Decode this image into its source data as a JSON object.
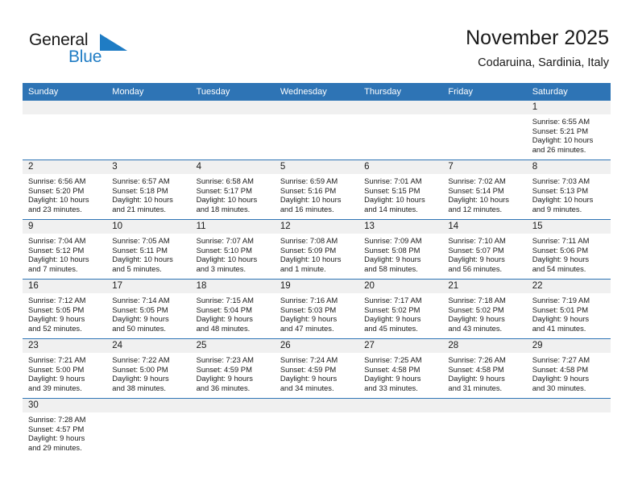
{
  "brand": {
    "name_top": "General",
    "name_bottom": "Blue",
    "accent_color": "#1f7cc4",
    "dark_color": "#1a1a1a"
  },
  "header": {
    "title": "November 2025",
    "subtitle": "Codaruina, Sardinia, Italy"
  },
  "theme": {
    "header_row_bg": "#2e74b5",
    "day_band_bg": "#f0f0f0",
    "row_divider": "#2e74b5",
    "text": "#1a1a1a"
  },
  "weekdays": [
    "Sunday",
    "Monday",
    "Tuesday",
    "Wednesday",
    "Thursday",
    "Friday",
    "Saturday"
  ],
  "labels": {
    "sunrise": "Sunrise:",
    "sunset": "Sunset:",
    "daylight": "Daylight:"
  },
  "weeks": [
    [
      {
        "day": "",
        "empty": true
      },
      {
        "day": "",
        "empty": true
      },
      {
        "day": "",
        "empty": true
      },
      {
        "day": "",
        "empty": true
      },
      {
        "day": "",
        "empty": true
      },
      {
        "day": "",
        "empty": true
      },
      {
        "day": "1",
        "sunrise": "Sunrise: 6:55 AM",
        "sunset": "Sunset: 5:21 PM",
        "daylight_line1": "Daylight: 10 hours",
        "daylight_line2": "and 26 minutes."
      }
    ],
    [
      {
        "day": "2",
        "sunrise": "Sunrise: 6:56 AM",
        "sunset": "Sunset: 5:20 PM",
        "daylight_line1": "Daylight: 10 hours",
        "daylight_line2": "and 23 minutes."
      },
      {
        "day": "3",
        "sunrise": "Sunrise: 6:57 AM",
        "sunset": "Sunset: 5:18 PM",
        "daylight_line1": "Daylight: 10 hours",
        "daylight_line2": "and 21 minutes."
      },
      {
        "day": "4",
        "sunrise": "Sunrise: 6:58 AM",
        "sunset": "Sunset: 5:17 PM",
        "daylight_line1": "Daylight: 10 hours",
        "daylight_line2": "and 18 minutes."
      },
      {
        "day": "5",
        "sunrise": "Sunrise: 6:59 AM",
        "sunset": "Sunset: 5:16 PM",
        "daylight_line1": "Daylight: 10 hours",
        "daylight_line2": "and 16 minutes."
      },
      {
        "day": "6",
        "sunrise": "Sunrise: 7:01 AM",
        "sunset": "Sunset: 5:15 PM",
        "daylight_line1": "Daylight: 10 hours",
        "daylight_line2": "and 14 minutes."
      },
      {
        "day": "7",
        "sunrise": "Sunrise: 7:02 AM",
        "sunset": "Sunset: 5:14 PM",
        "daylight_line1": "Daylight: 10 hours",
        "daylight_line2": "and 12 minutes."
      },
      {
        "day": "8",
        "sunrise": "Sunrise: 7:03 AM",
        "sunset": "Sunset: 5:13 PM",
        "daylight_line1": "Daylight: 10 hours",
        "daylight_line2": "and 9 minutes."
      }
    ],
    [
      {
        "day": "9",
        "sunrise": "Sunrise: 7:04 AM",
        "sunset": "Sunset: 5:12 PM",
        "daylight_line1": "Daylight: 10 hours",
        "daylight_line2": "and 7 minutes."
      },
      {
        "day": "10",
        "sunrise": "Sunrise: 7:05 AM",
        "sunset": "Sunset: 5:11 PM",
        "daylight_line1": "Daylight: 10 hours",
        "daylight_line2": "and 5 minutes."
      },
      {
        "day": "11",
        "sunrise": "Sunrise: 7:07 AM",
        "sunset": "Sunset: 5:10 PM",
        "daylight_line1": "Daylight: 10 hours",
        "daylight_line2": "and 3 minutes."
      },
      {
        "day": "12",
        "sunrise": "Sunrise: 7:08 AM",
        "sunset": "Sunset: 5:09 PM",
        "daylight_line1": "Daylight: 10 hours",
        "daylight_line2": "and 1 minute."
      },
      {
        "day": "13",
        "sunrise": "Sunrise: 7:09 AM",
        "sunset": "Sunset: 5:08 PM",
        "daylight_line1": "Daylight: 9 hours",
        "daylight_line2": "and 58 minutes."
      },
      {
        "day": "14",
        "sunrise": "Sunrise: 7:10 AM",
        "sunset": "Sunset: 5:07 PM",
        "daylight_line1": "Daylight: 9 hours",
        "daylight_line2": "and 56 minutes."
      },
      {
        "day": "15",
        "sunrise": "Sunrise: 7:11 AM",
        "sunset": "Sunset: 5:06 PM",
        "daylight_line1": "Daylight: 9 hours",
        "daylight_line2": "and 54 minutes."
      }
    ],
    [
      {
        "day": "16",
        "sunrise": "Sunrise: 7:12 AM",
        "sunset": "Sunset: 5:05 PM",
        "daylight_line1": "Daylight: 9 hours",
        "daylight_line2": "and 52 minutes."
      },
      {
        "day": "17",
        "sunrise": "Sunrise: 7:14 AM",
        "sunset": "Sunset: 5:05 PM",
        "daylight_line1": "Daylight: 9 hours",
        "daylight_line2": "and 50 minutes."
      },
      {
        "day": "18",
        "sunrise": "Sunrise: 7:15 AM",
        "sunset": "Sunset: 5:04 PM",
        "daylight_line1": "Daylight: 9 hours",
        "daylight_line2": "and 48 minutes."
      },
      {
        "day": "19",
        "sunrise": "Sunrise: 7:16 AM",
        "sunset": "Sunset: 5:03 PM",
        "daylight_line1": "Daylight: 9 hours",
        "daylight_line2": "and 47 minutes."
      },
      {
        "day": "20",
        "sunrise": "Sunrise: 7:17 AM",
        "sunset": "Sunset: 5:02 PM",
        "daylight_line1": "Daylight: 9 hours",
        "daylight_line2": "and 45 minutes."
      },
      {
        "day": "21",
        "sunrise": "Sunrise: 7:18 AM",
        "sunset": "Sunset: 5:02 PM",
        "daylight_line1": "Daylight: 9 hours",
        "daylight_line2": "and 43 minutes."
      },
      {
        "day": "22",
        "sunrise": "Sunrise: 7:19 AM",
        "sunset": "Sunset: 5:01 PM",
        "daylight_line1": "Daylight: 9 hours",
        "daylight_line2": "and 41 minutes."
      }
    ],
    [
      {
        "day": "23",
        "sunrise": "Sunrise: 7:21 AM",
        "sunset": "Sunset: 5:00 PM",
        "daylight_line1": "Daylight: 9 hours",
        "daylight_line2": "and 39 minutes."
      },
      {
        "day": "24",
        "sunrise": "Sunrise: 7:22 AM",
        "sunset": "Sunset: 5:00 PM",
        "daylight_line1": "Daylight: 9 hours",
        "daylight_line2": "and 38 minutes."
      },
      {
        "day": "25",
        "sunrise": "Sunrise: 7:23 AM",
        "sunset": "Sunset: 4:59 PM",
        "daylight_line1": "Daylight: 9 hours",
        "daylight_line2": "and 36 minutes."
      },
      {
        "day": "26",
        "sunrise": "Sunrise: 7:24 AM",
        "sunset": "Sunset: 4:59 PM",
        "daylight_line1": "Daylight: 9 hours",
        "daylight_line2": "and 34 minutes."
      },
      {
        "day": "27",
        "sunrise": "Sunrise: 7:25 AM",
        "sunset": "Sunset: 4:58 PM",
        "daylight_line1": "Daylight: 9 hours",
        "daylight_line2": "and 33 minutes."
      },
      {
        "day": "28",
        "sunrise": "Sunrise: 7:26 AM",
        "sunset": "Sunset: 4:58 PM",
        "daylight_line1": "Daylight: 9 hours",
        "daylight_line2": "and 31 minutes."
      },
      {
        "day": "29",
        "sunrise": "Sunrise: 7:27 AM",
        "sunset": "Sunset: 4:58 PM",
        "daylight_line1": "Daylight: 9 hours",
        "daylight_line2": "and 30 minutes."
      }
    ],
    [
      {
        "day": "30",
        "sunrise": "Sunrise: 7:28 AM",
        "sunset": "Sunset: 4:57 PM",
        "daylight_line1": "Daylight: 9 hours",
        "daylight_line2": "and 29 minutes."
      },
      {
        "day": "",
        "empty": true
      },
      {
        "day": "",
        "empty": true
      },
      {
        "day": "",
        "empty": true
      },
      {
        "day": "",
        "empty": true
      },
      {
        "day": "",
        "empty": true
      },
      {
        "day": "",
        "empty": true
      }
    ]
  ]
}
